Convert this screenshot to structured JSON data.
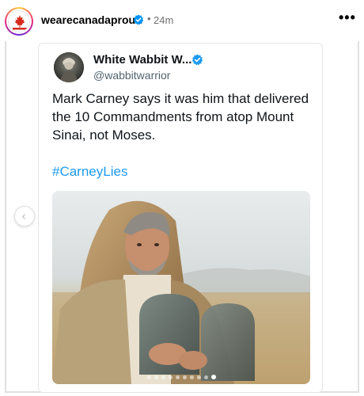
{
  "header": {
    "username": "wearecanadaproud",
    "separator": "•",
    "time": "24m",
    "more": "•••"
  },
  "tweet": {
    "display_name": "White Wabbit W...",
    "handle": "@wabbitwarrior",
    "text": "Mark Carney says it was him that delivered the 10 Commandments from atop Mount Sinai, not Moses.",
    "hashtag": "#CarneyLies"
  },
  "carousel": {
    "total_dots": 10,
    "active_index": 9,
    "prev_icon": "chevron-left-icon"
  },
  "colors": {
    "verified_blue": "#0095f6",
    "hashtag_blue": "#1d9bf0",
    "muted": "#737373"
  }
}
